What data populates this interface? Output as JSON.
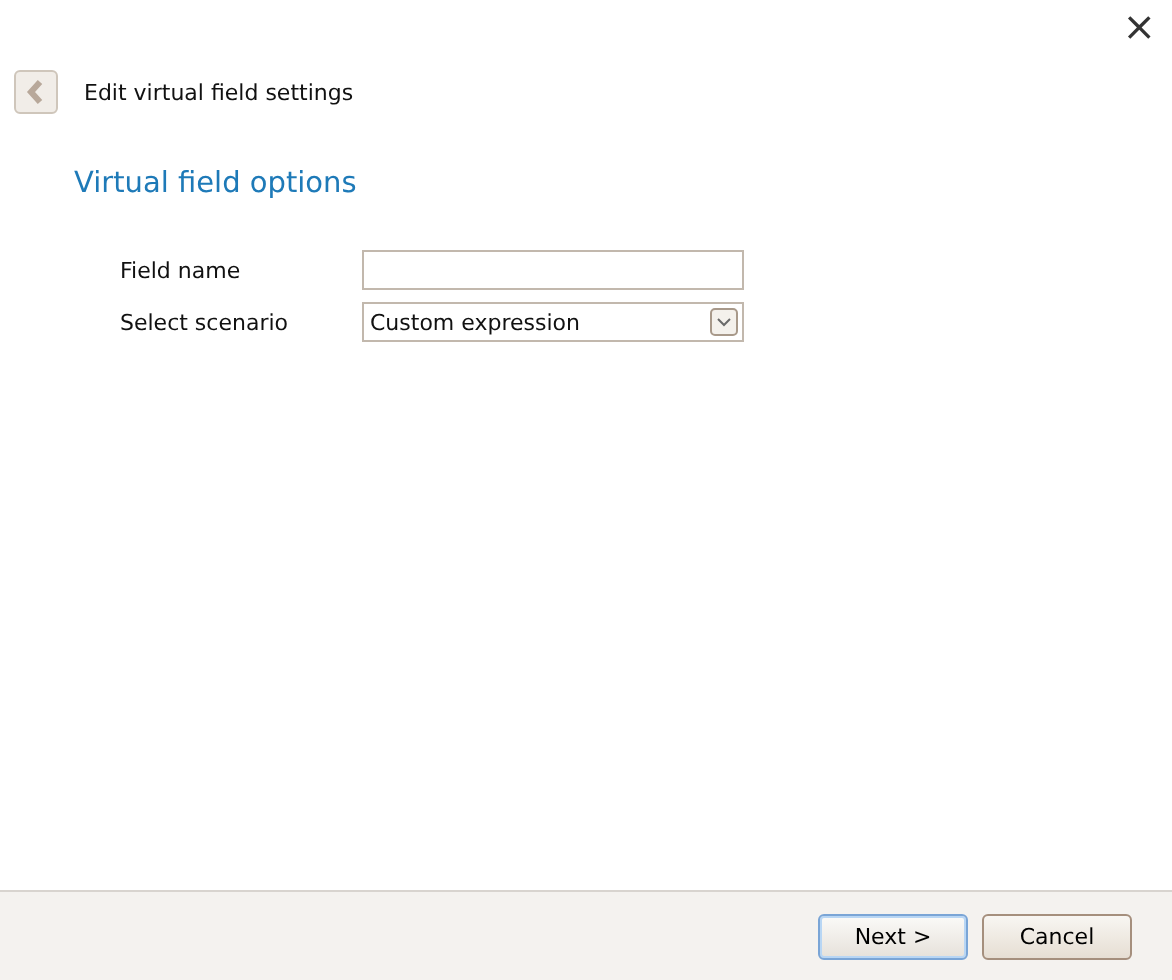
{
  "close_button": "×",
  "header": {
    "title": "Edit virtual field settings"
  },
  "section_title": "Virtual field options",
  "form": [
    {
      "kind": "text",
      "label": "Field name"
    },
    {
      "kind": "select",
      "label": "Select scenario",
      "value": "Custom expression"
    }
  ],
  "buttons": [
    {
      "label": "Next >",
      "default": true
    },
    {
      "label": "Cancel",
      "default": false
    }
  ]
}
